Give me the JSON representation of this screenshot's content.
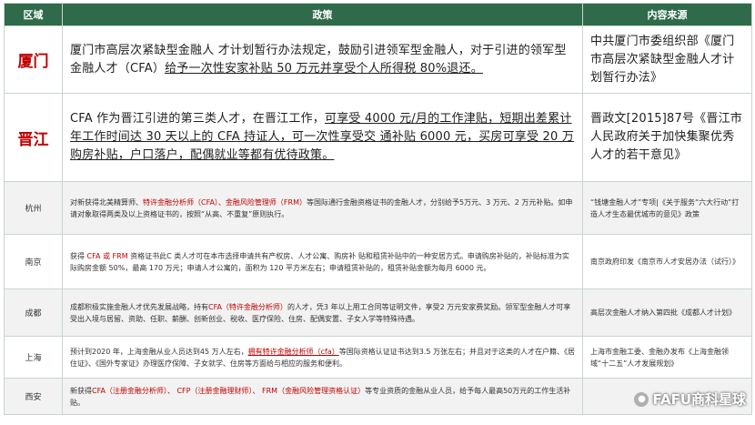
{
  "header": {
    "region": "区域",
    "policy": "政策",
    "source": "内容来源"
  },
  "rows": [
    {
      "region": "厦门",
      "policy_plain": "厦门市高层次紧缺型金融人 才计划暂行办法规定，鼓励引进领军型金融人，对于引进的领军型金融人才（CFA）",
      "policy_ul": "给予一次性安家补贴 50 万元并享受个人所得税 80%退还。",
      "source": "中共厦门市委组织部《厦门市高层次紧缺型金融人才计划暂行办法》"
    },
    {
      "region": "晋江",
      "policy_a": "CFA 作为晋江引进的第三类人才，在晋江工作，",
      "policy_b": "可享受 4000 元/月的工作津贴，短期出差累计年工作时间达 30 天以上的 CFA 持证人，可一次性享受交 通补贴 6000 元，买房可享受 20 万购房补贴，户口落户，配偶就业等都有优待政策。",
      "source": "晋政文[2015]87号《晋江市人民政府关于加快集聚优秀人才的若干意见》"
    },
    {
      "region": "杭州",
      "p1": "对新获得北美精算师、",
      "p2": "特许金融分析师（CFA）、金融风险管理师（FRM）",
      "p3": "等国际通行金融资格证书的金融人才，分别给予5万元、3 万元、2 万元补贴。如申请对象取得两类及以上资格证书的，按照“从高、不重复”原则执行。",
      "source": "“钱塘金融人才”专项|《关于服务“六大行动”打造人才生态最优城市的意见》政策"
    },
    {
      "region": "南京",
      "p1": "获得 ",
      "p2": "CFA 或 FRM",
      "p3": " 资格证书此C 类人才可在本市选择申请共有产权房、人才公寓、购房补 贴和租赁补贴中的一种安居方式。申请购房补贴的，补贴标准为实际购房金额 50%，最高 170 万元；申请人才公寓的，面积为 120 平方米左右；申请租赁补贴的，租赁补贴金额为每月 6000 元。",
      "source": "南京政府印发《南京市人才安居办法（试行）》"
    },
    {
      "region": "成都",
      "p1": "成都积极实施金融人才优先发展战略，持有",
      "p2": "CFA（特许金融分析师）",
      "p3": "的人才，凭3 年以上用工合同等证明文件，享受2 万元安家费奖励。领军型金融人才可享受出入境与居留、资助、任职、薪酬、创新创业、税收、医疗保险、住房、配偶安置、子女入学等特殊待遇。",
      "source": "高层次金融人才纳入第四批《成都人才计划》"
    },
    {
      "region": "上海",
      "p1": "预计到2020 年，上海金融从业人员达到45 万人左右，",
      "p2": "拥有特许金融分析师（cfa）",
      "p3": "等国际资格认证证书达到3.5 万张左右；并且对于这类的人才在户籍、《居住证》、《国外专家证》办理医疗保障、子女就学、住房等方面给与相应的服务和便利。",
      "source": "上海市金融工委、金融办发布《上海金融领域“十二五”人才发展规划》"
    },
    {
      "region": "西安",
      "p1": "新获得",
      "p2": "CFA（注册金融分析师）、 CFP（注册金融理财师）、 FRM（金融风险管理资格认证）",
      "p3": "等专业资质的金融从业人员，给予每人最高50万元的工作生活补贴。",
      "source": ""
    }
  ],
  "watermark": {
    "text": "FAFU商科星球",
    "icon": "wechat-icon"
  },
  "colors": {
    "header_bg": "#2f6b4b",
    "highlight": "#c00000"
  }
}
